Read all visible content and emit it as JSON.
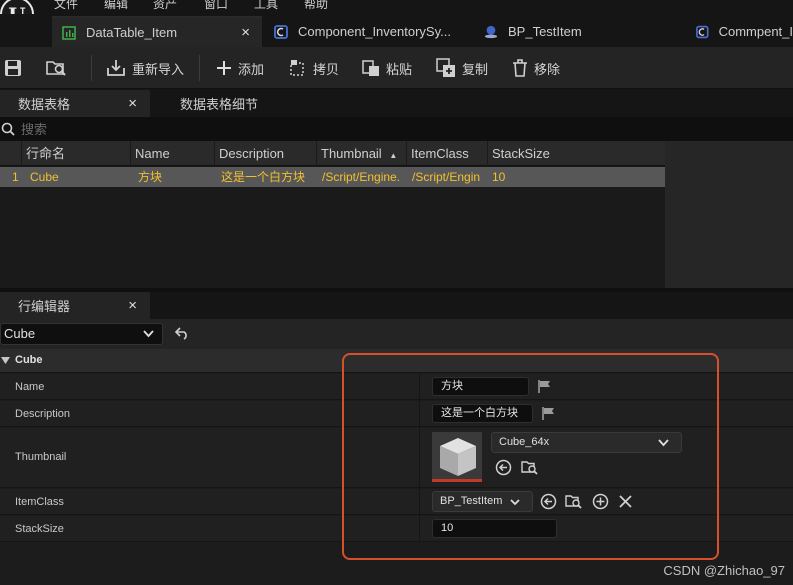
{
  "menu": [
    "文件",
    "编辑",
    "资产",
    "窗口",
    "工具",
    "帮助"
  ],
  "tabs": [
    {
      "label": "DataTable_Item",
      "close": "×"
    },
    {
      "label": "Component_InventorySy..."
    },
    {
      "label": "BP_TestItem"
    },
    {
      "label": "Commpent_I"
    }
  ],
  "toolbar": {
    "reimport": "重新导入",
    "add": "添加",
    "copy": "拷贝",
    "paste": "粘贴",
    "duplicate": "复制",
    "remove": "移除"
  },
  "panel_tabs": {
    "data_table": "数据表格",
    "close": "×",
    "details": "数据表格细节"
  },
  "search": {
    "placeholder": "搜索"
  },
  "table": {
    "headers": [
      "行命名",
      "Name",
      "Description",
      "Thumbnail",
      "ItemClass",
      "StackSize"
    ],
    "sort_indicator": "▲",
    "rows": [
      {
        "index": "1",
        "row_name": "Cube",
        "name": "方块",
        "description": "这是一个白方块",
        "thumbnail": "/Script/Engine.",
        "itemclass": "/Script/Engin",
        "stacksize": "10"
      }
    ]
  },
  "row_editor": {
    "title": "行编辑器",
    "close": "×",
    "selected_row": "Cube",
    "category": "Cube",
    "properties": {
      "name_label": "Name",
      "name_value": "方块",
      "desc_label": "Description",
      "desc_value": "这是一个白方块",
      "thumb_label": "Thumbnail",
      "thumb_asset": "Cube_64x",
      "itemclass_label": "ItemClass",
      "itemclass_value": "BP_TestItem",
      "stack_label": "StackSize",
      "stack_value": "10"
    }
  },
  "watermark": "CSDN @Zhichao_97",
  "colors": {
    "accent_highlight": "#d7502c",
    "row_text": "#f2c12e",
    "table_tab_icon": "#3fb04a",
    "blueprint_icon": "#4a6fd8"
  }
}
